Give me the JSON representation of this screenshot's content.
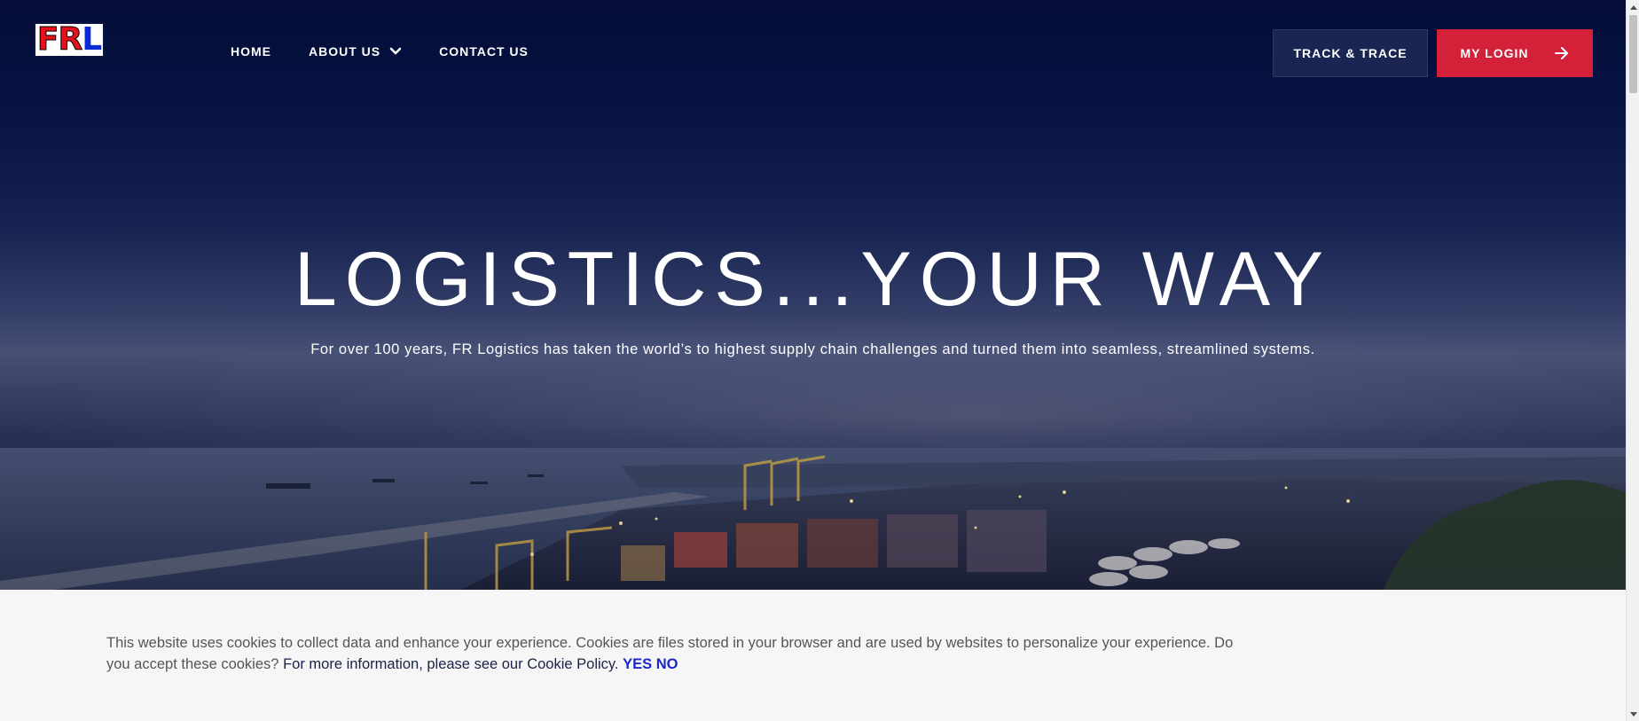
{
  "header": {
    "logo": {
      "letters": [
        "F",
        "R",
        "L"
      ]
    },
    "nav": [
      {
        "label": "HOME"
      },
      {
        "label": "ABOUT US",
        "has_dropdown": true
      },
      {
        "label": "CONTACT US"
      }
    ],
    "track_button": "TRACK & TRACE",
    "login_button": "MY LOGIN"
  },
  "hero": {
    "title": "LOGISTICS...YOUR WAY",
    "subtitle": "For over 100 years, FR Logistics has taken the world’s to highest supply chain challenges and turned them into seamless, streamlined systems."
  },
  "cookie": {
    "text": "This website uses cookies to collect data and enhance your experience. Cookies are files stored in your browser and are used by websites to personalize your experience. Do you accept these cookies?",
    "link": "For more information, please see our Cookie Policy.",
    "yes": "YES",
    "no": "NO"
  },
  "colors": {
    "navy": "#030e3a",
    "login_red": "#d3213a",
    "track_bg": "#1a2552",
    "cookie_accent": "#1a27c9"
  },
  "icons": [
    "chevron-down-icon",
    "arrow-right-icon",
    "scroll-up-icon",
    "scroll-down-icon"
  ]
}
